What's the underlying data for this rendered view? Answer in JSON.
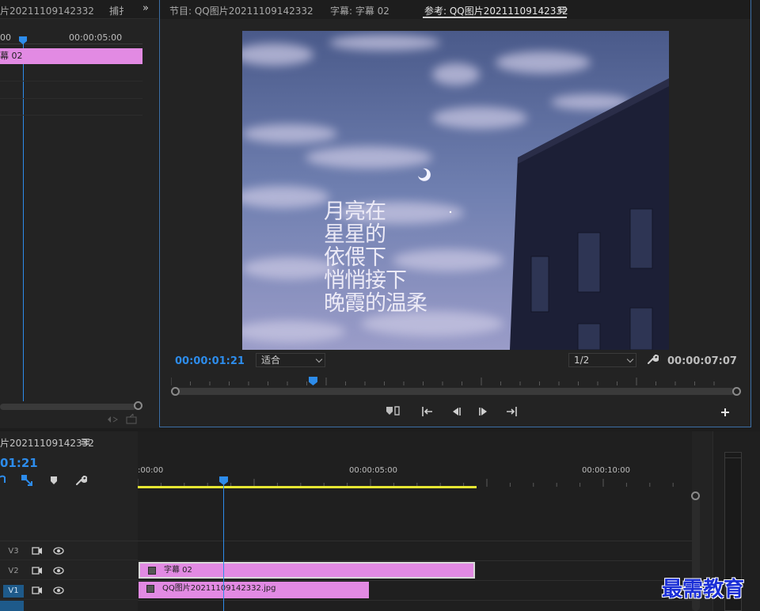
{
  "left_panel": {
    "tab_title": "片20211109142332",
    "tab_capture": "捕扌",
    "expand_icon": "double-chevron-right-icon",
    "ruler_start": "00",
    "ruler_mark": "00:00:05:00",
    "clip_label": "幕 02"
  },
  "program_panel": {
    "tabs": [
      {
        "label": "节目: QQ图片20211109142332"
      },
      {
        "label": "字幕: 字幕 02"
      },
      {
        "label": "参考: QQ图片20211109142332"
      }
    ],
    "menu_icon": "hamburger-icon",
    "subtitle_lines": [
      "月亮在",
      "星星的",
      "依偎下",
      "悄悄接下",
      "晚霞的温柔"
    ],
    "current_time": "00:00:01:21",
    "fit_value": "适合",
    "resolution_value": "1/2",
    "duration": "00:00:07:07",
    "playhead_fraction": 0.245
  },
  "timeline": {
    "sequence_name": "片20211109142332",
    "menu_icon": "hamburger-icon",
    "timecode": "01:21",
    "ruler_labels": [
      ":00:00",
      "00:00:05:00",
      "00:00:10:00"
    ],
    "tracks": [
      {
        "name": "V3"
      },
      {
        "name": "V2"
      },
      {
        "name": "V1"
      }
    ],
    "clips": [
      {
        "label": "字幕 02",
        "track": "V2"
      },
      {
        "label": "QQ图片20211109142332.jpg",
        "track": "V1"
      }
    ]
  },
  "watermark": "最需教育",
  "colors": {
    "accent": "#2d8ceb",
    "clip": "#e28ae3",
    "work_area": "#e6e632"
  }
}
